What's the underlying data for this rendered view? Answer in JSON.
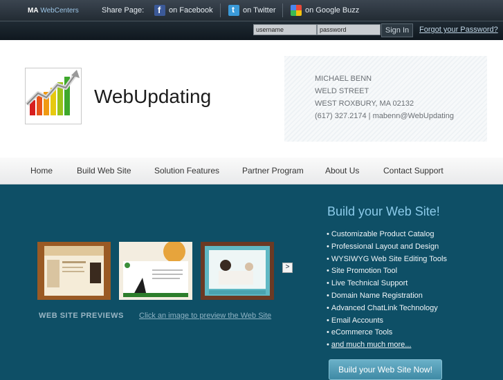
{
  "topbar": {
    "brand_ma": "MA",
    "brand_name": "WebCenters",
    "share_label": "Share Page:",
    "facebook": "on Facebook",
    "twitter": "on Twitter",
    "googlebuzz": "on Google Buzz"
  },
  "login": {
    "username_value": "username",
    "password_value": "password",
    "signin_label": "Sign In",
    "forgot_label": "Forgot your Password?"
  },
  "header": {
    "site_name": "WebUpdating",
    "contact": {
      "name": "MICHAEL BENN",
      "street": "WELD STREET",
      "city": "WEST ROXBURY, MA 02132",
      "phone_email": "(617) 327.2174 | mabenn@WebUpdating"
    }
  },
  "nav": {
    "items": [
      "Home",
      "Build Web Site",
      "Solution Features",
      "Partner Program",
      "About Us",
      "Contact Support"
    ]
  },
  "previews": {
    "label": "WEB SITE PREVIEWS",
    "hint": "Click an image to preview the Web Site",
    "next_label": ">"
  },
  "build": {
    "title": "Build your Web Site!",
    "features": [
      "Customizable Product Catalog",
      "Professional Layout and Design",
      "WYSIWYG Web Site Editing Tools",
      "Site Promotion Tool",
      "Live Technical Support",
      "Domain Name Registration",
      "Advanced ChatLink Technology",
      "Email Accounts",
      "eCommerce Tools"
    ],
    "more": "and much much more...",
    "cta": "Build your Web Site Now!"
  }
}
